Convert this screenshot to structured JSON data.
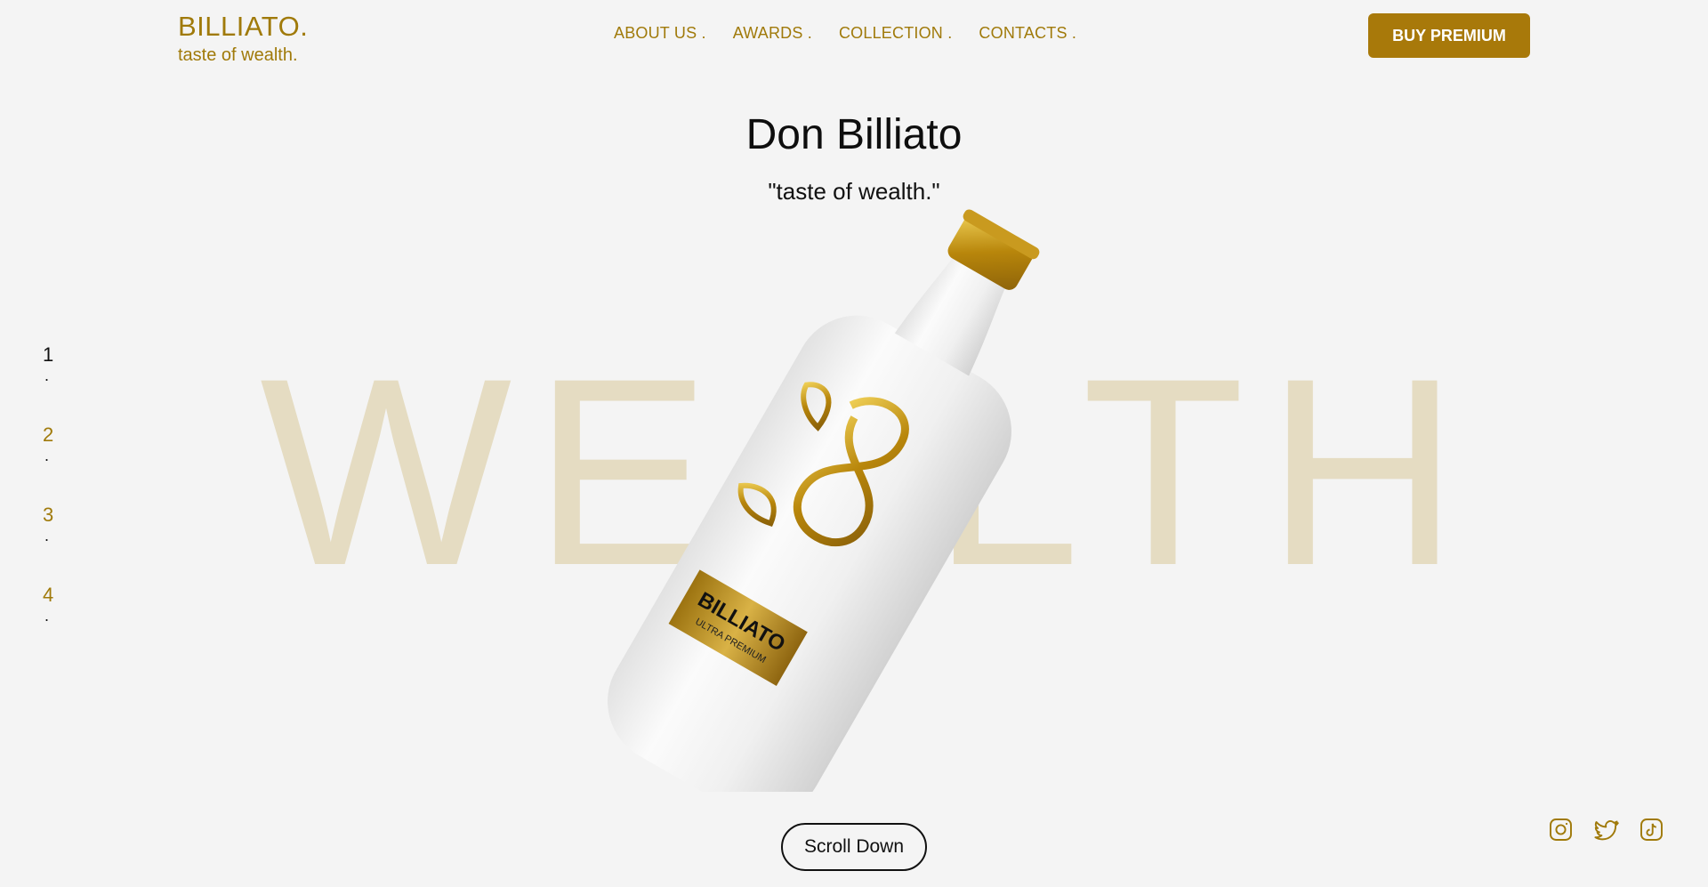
{
  "brand": {
    "name": "BILLIATO.",
    "tagline": "taste of wealth."
  },
  "nav": {
    "items": [
      "ABOUT US .",
      "AWARDS .",
      "COLLECTION .",
      "CONTACTS ."
    ]
  },
  "header": {
    "cta_label": "BUY PREMIUM"
  },
  "hero": {
    "title": "Don Billiato",
    "subtitle": "\"taste of wealth.\"",
    "background_word": "WEALTH",
    "bottle_label": "BILLIATO",
    "bottle_sublabel": "ULTRA PREMIUM"
  },
  "pager": {
    "items": [
      {
        "num": "1",
        "dot": "."
      },
      {
        "num": "2",
        "dot": "."
      },
      {
        "num": "3",
        "dot": "."
      },
      {
        "num": "4",
        "dot": "."
      }
    ],
    "active_index": 0
  },
  "scroll": {
    "label": "Scroll Down"
  },
  "socials": [
    "instagram-icon",
    "twitter-icon",
    "tiktok-icon"
  ],
  "colors": {
    "accent": "#a07a0a",
    "button": "#a8790a",
    "background": "#f4f4f4",
    "watermark": "#e5dcc2"
  }
}
